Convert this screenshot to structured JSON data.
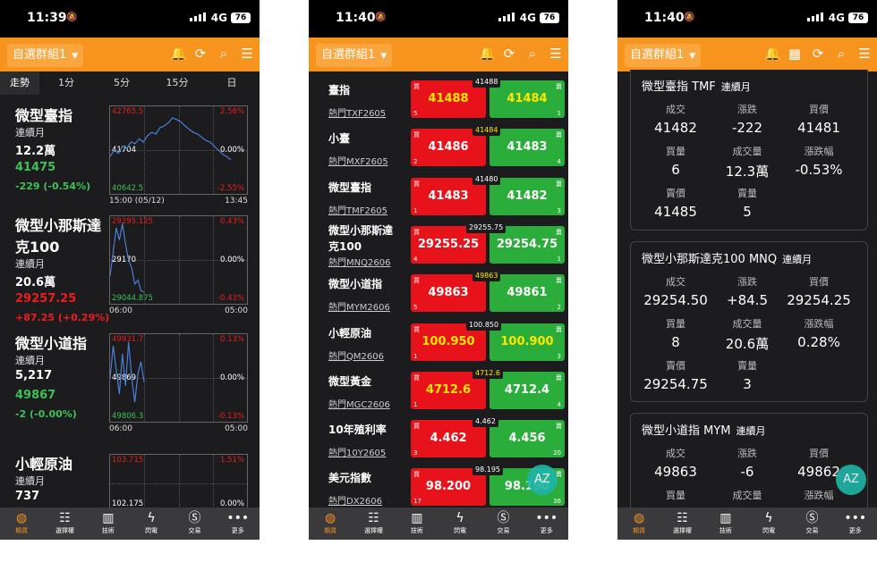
{
  "colors": {
    "orange": "#f7941d",
    "up": "#f01c1c",
    "down": "#3cc156",
    "highlight": "#ffe600"
  },
  "screens": [
    {
      "time": "11:39",
      "net": "4G",
      "batt": "76"
    },
    {
      "time": "11:40",
      "net": "4G",
      "batt": "76"
    },
    {
      "time": "11:40",
      "net": "4G",
      "batt": "76"
    }
  ],
  "group": "自選群組1",
  "tabs": [
    "走勢",
    "1分",
    "5分",
    "15分",
    "日"
  ],
  "trend": [
    {
      "name": "微型臺指",
      "cont": "連續月",
      "vol": "12.2萬",
      "price": "41475",
      "change": "-229 (-0.54%)",
      "dir": "down",
      "hi": "42765.5",
      "hiPct": "2.56%",
      "mid": "41704",
      "midPct": "0.00%",
      "lo": "40642.5",
      "loPct": "-2.55%",
      "t0": "15:00 (05/12)",
      "t1": "13:45",
      "series": [
        0.42,
        0.5,
        0.46,
        0.55,
        0.52,
        0.6,
        0.58,
        0.64,
        0.6,
        0.68,
        0.72,
        0.7,
        0.78,
        0.8,
        0.84,
        0.9,
        0.88,
        0.85,
        0.8,
        0.76,
        0.72,
        0.7,
        0.66,
        0.62,
        0.6,
        0.55,
        0.5,
        0.45,
        0.42,
        0.38
      ]
    },
    {
      "name": "微型小那斯達克100",
      "cont": "連續月",
      "vol": "20.6萬",
      "price": "29257.25",
      "change": "+87.25 (+0.29%)",
      "dir": "up",
      "hi": "29295.125",
      "hiPct": "0.43%",
      "mid": "29170",
      "midPct": "0.00%",
      "lo": "29044.875",
      "loPct": "-0.43%",
      "t0": "06:00",
      "t1": "05:00",
      "series": [
        0.3,
        0.6,
        0.9,
        0.75,
        0.95,
        0.7,
        0.5,
        0.4,
        0.2,
        0.25,
        0.12,
        0.1
      ]
    },
    {
      "name": "微型小道指",
      "cont": "連續月",
      "vol": "5,217",
      "price": "49867",
      "change": "-2 (-0.00%)",
      "dir": "down",
      "hi": "49931.7",
      "hiPct": "0.13%",
      "mid": "49869",
      "midPct": "0.00%",
      "lo": "49806.3",
      "loPct": "-0.13%",
      "t0": "06:00",
      "t1": "05:00",
      "series": [
        0.5,
        0.9,
        0.6,
        0.3,
        0.8,
        0.4,
        0.95,
        0.5,
        0.2,
        0.55,
        0.7,
        0.45
      ]
    },
    {
      "name": "小輕原油",
      "cont": "連續月",
      "vol": "737",
      "hi": "103.715",
      "hiPct": "1.51%",
      "mid": "102.175",
      "midPct": "0.00%"
    }
  ],
  "quotes": [
    {
      "name": "臺指",
      "sub": "熱門TXF2605",
      "last": "41488",
      "bid": "41488",
      "ask": "41484",
      "bidQ": "5",
      "askQ": "1",
      "bidY": true,
      "askY": true,
      "lastY": false
    },
    {
      "name": "小臺",
      "sub": "熱門MXF2605",
      "last": "41484",
      "bid": "41486",
      "ask": "41483",
      "bidQ": "2",
      "askQ": "4",
      "bidY": false,
      "askY": false,
      "lastY": true
    },
    {
      "name": "微型臺指",
      "sub": "熱門TMF2605",
      "last": "41480",
      "bid": "41483",
      "ask": "41482",
      "bidQ": "1",
      "askQ": "3",
      "bidY": false,
      "askY": false,
      "lastY": false
    },
    {
      "name": "微型小那斯達克100",
      "sub": "熱門MNQ2606",
      "last": "29255.75",
      "bid": "29255.25",
      "ask": "29254.75",
      "bidQ": "4",
      "askQ": "1",
      "bidY": false,
      "askY": false,
      "lastY": false
    },
    {
      "name": "微型小道指",
      "sub": "熱門MYM2606",
      "last": "49863",
      "bid": "49863",
      "ask": "49861",
      "bidQ": "5",
      "askQ": "2",
      "bidY": false,
      "askY": false,
      "lastY": true
    },
    {
      "name": "小輕原油",
      "sub": "熱門QM2606",
      "last": "100.850",
      "bid": "100.950",
      "ask": "100.900",
      "bidQ": "1",
      "askQ": "3",
      "bidY": true,
      "askY": true,
      "lastY": false
    },
    {
      "name": "微型黃金",
      "sub": "熱門MGC2606",
      "last": "4712.6",
      "bid": "4712.6",
      "ask": "4712.4",
      "bidQ": "1",
      "askQ": "4",
      "bidY": true,
      "askY": false,
      "lastY": true
    },
    {
      "name": "10年殖利率",
      "sub": "熱門10Y2605",
      "last": "4.462",
      "bid": "4.462",
      "ask": "4.456",
      "bidQ": "3",
      "askQ": "20",
      "bidY": false,
      "askY": false,
      "lastY": false
    },
    {
      "name": "美元指數",
      "sub": "熱門DX2606",
      "last": "98.195",
      "bid": "98.200",
      "ask": "98.190",
      "bidQ": "17",
      "askQ": "36",
      "bidY": false,
      "askY": false,
      "lastY": false
    }
  ],
  "bidLabel": "買",
  "askLabel": "賣",
  "details": [
    {
      "title": "微型臺指 TMF",
      "cont": "連續月",
      "cells": [
        [
          "成交",
          "41482",
          "g"
        ],
        [
          "漲跌",
          "-222",
          "g"
        ],
        [
          "買價",
          "41481",
          "g"
        ],
        [
          "買量",
          "6",
          "w"
        ],
        [
          "成交量",
          "12.3萬",
          "w"
        ],
        [
          "漲跌幅",
          "-0.53%",
          "g"
        ],
        [
          "賣價",
          "41485",
          "g"
        ],
        [
          "賣量",
          "5",
          "w"
        ]
      ]
    },
    {
      "title": "微型小那斯達克100 MNQ",
      "cont": "連續月",
      "cells": [
        [
          "成交",
          "29254.50",
          "r"
        ],
        [
          "漲跌",
          "+84.5",
          "r"
        ],
        [
          "買價",
          "29254.25",
          "r"
        ],
        [
          "買量",
          "8",
          "w"
        ],
        [
          "成交量",
          "20.6萬",
          "w"
        ],
        [
          "漲跌幅",
          "0.28%",
          "r"
        ],
        [
          "賣價",
          "29254.75",
          "r"
        ],
        [
          "賣量",
          "3",
          "w"
        ]
      ]
    },
    {
      "title": "微型小道指 MYM",
      "cont": "連續月",
      "cells": [
        [
          "成交",
          "49863",
          "g"
        ],
        [
          "漲跌",
          "-6",
          "g"
        ],
        [
          "買價",
          "49862",
          "g"
        ],
        [
          "買量",
          "",
          "w"
        ],
        [
          "成交量",
          "",
          "w"
        ],
        [
          "漲跌幅",
          "",
          "w"
        ]
      ]
    }
  ],
  "bottomNav": [
    "期貨",
    "選擇權",
    "技術",
    "閃電",
    "交易",
    "更多"
  ],
  "navIcons": [
    "globe-icon",
    "list-icon",
    "bar-chart-icon",
    "lightning-icon",
    "dollar-icon",
    "more-icon"
  ],
  "bubble": "AZ"
}
